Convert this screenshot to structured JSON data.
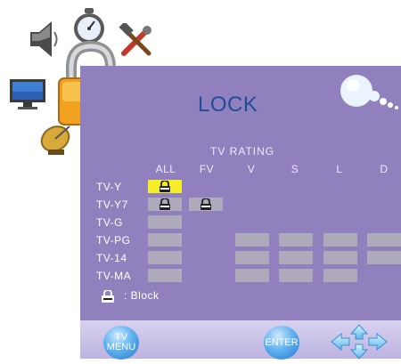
{
  "menu": {
    "title": "LOCK",
    "section_label": "TV RATING",
    "icons": [
      "speaker-icon",
      "stopwatch-icon",
      "tools-icon",
      "monitor-icon",
      "lock-icon",
      "satellite-dish-icon"
    ]
  },
  "table": {
    "columns": [
      "ALL",
      "FV",
      "V",
      "S",
      "L",
      "D"
    ],
    "rows": [
      {
        "label": "TV-Y",
        "cells": [
          "selected-locked",
          null,
          null,
          null,
          null,
          null
        ]
      },
      {
        "label": "TV-Y7",
        "cells": [
          "locked",
          "locked",
          null,
          null,
          null,
          null
        ]
      },
      {
        "label": "TV-G",
        "cells": [
          "empty",
          null,
          null,
          null,
          null,
          null
        ]
      },
      {
        "label": "TV-PG",
        "cells": [
          "empty",
          null,
          "empty",
          "empty",
          "empty",
          "empty"
        ]
      },
      {
        "label": "TV-14",
        "cells": [
          "empty",
          null,
          "empty",
          "empty",
          "empty",
          "empty"
        ]
      },
      {
        "label": "TV-MA",
        "cells": [
          "empty",
          null,
          "empty",
          "empty",
          "empty",
          null
        ]
      }
    ]
  },
  "legend": {
    "text": ": Block"
  },
  "footer": {
    "menu_label_line1": "TV",
    "menu_label_line2": "MENU",
    "enter_label": "ENTER",
    "nav_icon": "directional-arrows-icon"
  },
  "colors": {
    "panel": "#9080bd",
    "title": "#1f4e99",
    "selected_cell": "#f3ee27",
    "cell": "#aeaabc",
    "button": "#3a8ee0"
  }
}
